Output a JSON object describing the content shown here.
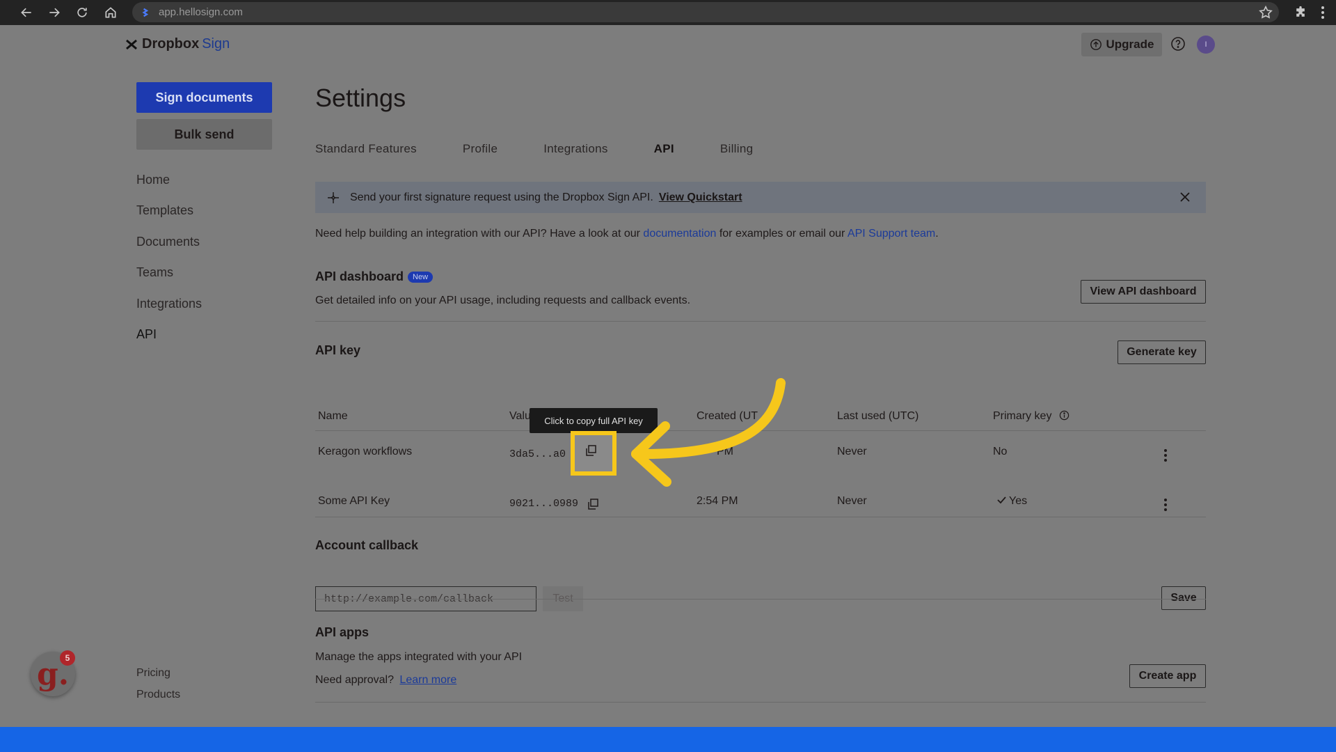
{
  "browser": {
    "url": "app.hellosign.com"
  },
  "header": {
    "logo_brand": "Dropbox",
    "logo_product": "Sign",
    "upgrade_label": "Upgrade",
    "avatar_initial": "I"
  },
  "sidebar": {
    "sign_documents": "Sign documents",
    "bulk_send": "Bulk send",
    "items": [
      "Home",
      "Templates",
      "Documents",
      "Teams",
      "Integrations",
      "API"
    ],
    "footer": [
      "Pricing",
      "Products"
    ],
    "notification_count": "5",
    "assistant_letter": "g."
  },
  "main": {
    "title": "Settings",
    "tabs": [
      "Standard Features",
      "Profile",
      "Integrations",
      "API",
      "Billing"
    ],
    "banner": {
      "text": "Send your first signature request using the Dropbox Sign API.",
      "link": "View Quickstart"
    },
    "help": {
      "pre": "Need help building an integration with our API? Have a look at our ",
      "doc_link": "documentation",
      "mid": " for examples or email our ",
      "support_link": "API Support team",
      "post": "."
    },
    "api_dashboard": {
      "title": "API dashboard",
      "badge": "New",
      "description": "Get detailed info on your API usage, including requests and callback events.",
      "button": "View API dashboard"
    },
    "api_key": {
      "title": "API key",
      "generate_button": "Generate key",
      "columns": {
        "name": "Name",
        "value": "Valu",
        "created": "Created (UT",
        "last_used": "Last used (UTC)",
        "primary": "Primary key"
      },
      "rows": [
        {
          "name": "Keragon workflows",
          "value": "3da5...a0 d",
          "created": "PM",
          "last_used": "Never",
          "primary": "No"
        },
        {
          "name": "Some API Key",
          "value": "9021...0989",
          "created": "2:54 PM",
          "last_used": "Never",
          "primary": "Yes"
        }
      ],
      "tooltip": "Click to copy full API key"
    },
    "account_callback": {
      "title": "Account callback",
      "placeholder": "http://example.com/callback",
      "test_button": "Test",
      "save_button": "Save"
    },
    "api_apps": {
      "title": "API apps",
      "description": "Manage the apps integrated with your API",
      "approval_text": "Need approval?",
      "learn_more": "Learn more",
      "create_button": "Create app"
    }
  },
  "colors": {
    "accent_blue": "#1d3ab0",
    "highlight_yellow": "#f6c71b",
    "bottom_band": "#1565e6"
  }
}
